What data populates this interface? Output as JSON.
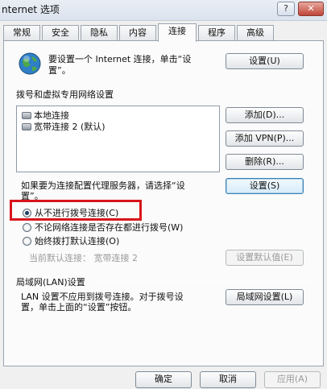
{
  "window": {
    "title": "nternet 选项",
    "help_label": "?",
    "close_label": "✕"
  },
  "tabs": [
    {
      "label": "常规"
    },
    {
      "label": "安全"
    },
    {
      "label": "隐私"
    },
    {
      "label": "内容"
    },
    {
      "label": "连接",
      "active": true
    },
    {
      "label": "程序"
    },
    {
      "label": "高级"
    }
  ],
  "setup": {
    "text_line1": "要设置一个 Internet 连接，单击“设",
    "text_line2": "置”。",
    "button": "设置(U)"
  },
  "dialup": {
    "heading": "拨号和虚拟专用网络设置",
    "connections": [
      {
        "name": "本地连接"
      },
      {
        "name": "宽带连接 2 (默认)"
      }
    ],
    "add_button": "添加(D)...",
    "add_vpn_button": "添加 VPN(P)...",
    "remove_button": "删除(R)...",
    "proxy_text_line1": "如果要为连接配置代理服务器，请选择“设",
    "proxy_text_line2": "置”。",
    "settings_button": "设置(S)"
  },
  "dial_options": [
    {
      "label": "从不进行拨号连接(C)",
      "checked": true,
      "highlighted": true
    },
    {
      "label": "不论网络连接是否存在都进行拨号(W)",
      "checked": false
    },
    {
      "label": "始终拨打默认连接(O)",
      "checked": false
    }
  ],
  "default_connection": {
    "label": "当前默认连接：",
    "value": "宽带连接 2",
    "button": "设置默认值(E)"
  },
  "lan": {
    "heading": "局域网(LAN)设置",
    "text_line1": "LAN 设置不应用到拨号连接。对于拨号设",
    "text_line2": "置，单击上面的“设置”按钮。",
    "button": "局域网设置(L)"
  },
  "footer": {
    "ok": "确定",
    "cancel": "取消",
    "apply": "应用(A)"
  },
  "colors": {
    "highlight_border": "#d8151b",
    "window_bg": "#f0f0f0"
  }
}
